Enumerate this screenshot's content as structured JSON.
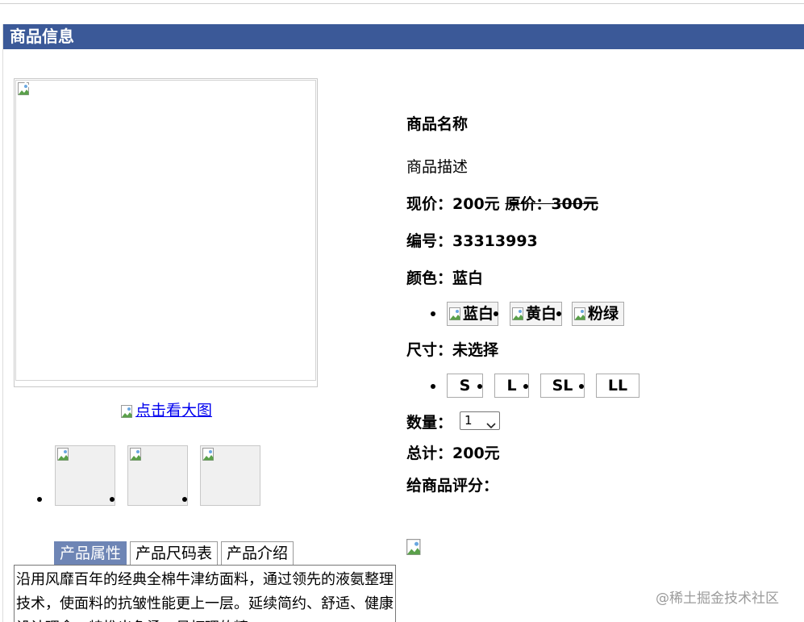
{
  "header": {
    "title": "商品信息"
  },
  "gallery": {
    "enlarge_link": "点击看大图",
    "thumb_count": 3
  },
  "tabs": [
    {
      "label": "产品属性",
      "active": true
    },
    {
      "label": "产品尺码表",
      "active": false
    },
    {
      "label": "产品介绍",
      "active": false
    }
  ],
  "description": "沿用风靡百年的经典全棉牛津纺面料，通过领先的液氨整理技术，使面料的抗皱性能更上一层。延续简约、舒适、健康设计理念，特推出免烫、易打理的精",
  "product": {
    "name": "商品名称",
    "desc": "商品描述",
    "current_price_label": "现价：",
    "current_price": "200元",
    "original_price_label": "原价：",
    "original_price": "300元",
    "sku_label": "编号：",
    "sku": "33313993",
    "color_label": "颜色：",
    "color_selected": "蓝白",
    "color_options": [
      "蓝白",
      "黄白",
      "粉绿"
    ],
    "size_label": "尺寸：",
    "size_selected": "未选择",
    "size_options": [
      "S",
      "L",
      "SL",
      "LL"
    ],
    "quantity_label": "数量：",
    "quantity_value": "1",
    "total_label": "总计：",
    "total": "200元",
    "rating_label": "给商品评分："
  },
  "watermark": "@稀土掘金技术社区",
  "colors": {
    "header_bg": "#3b5998",
    "active_tab_bg": "#6e85b5",
    "link": "#0000ee"
  }
}
